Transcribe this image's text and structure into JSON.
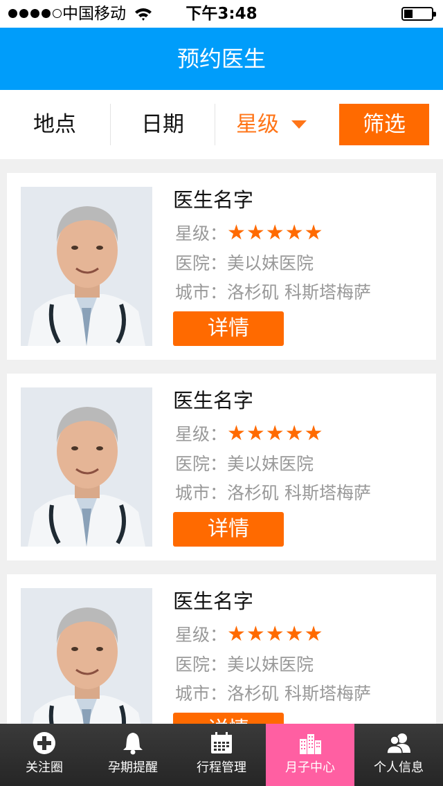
{
  "status_bar": {
    "carrier": "中国移动",
    "time": "下午3:48",
    "signal_bars": 4,
    "signal_total": 5
  },
  "nav": {
    "title": "预约医生"
  },
  "filters": {
    "location": "地点",
    "date": "日期",
    "star": "星级",
    "filter_button": "筛选"
  },
  "doctors": [
    {
      "name": "医生名字",
      "star_label": "星级：",
      "stars": "★★★★★",
      "hospital": "医院：美以妹医院",
      "city": "城市：洛杉矶 科斯塔梅萨",
      "detail": "详情"
    },
    {
      "name": "医生名字",
      "star_label": "星级：",
      "stars": "★★★★★",
      "hospital": "医院：美以妹医院",
      "city": "城市：洛杉矶 科斯塔梅萨",
      "detail": "详情"
    },
    {
      "name": "医生名字",
      "star_label": "星级：",
      "stars": "★★★★★",
      "hospital": "医院：美以妹医院",
      "city": "城市：洛杉矶 科斯塔梅萨",
      "detail": "详情"
    }
  ],
  "tabs": [
    {
      "label": "关注圈",
      "icon": "plus-circle-icon"
    },
    {
      "label": "孕期提醒",
      "icon": "bell-icon"
    },
    {
      "label": "行程管理",
      "icon": "calendar-icon"
    },
    {
      "label": "月子中心",
      "icon": "buildings-icon",
      "active": true
    },
    {
      "label": "个人信息",
      "icon": "users-icon"
    }
  ],
  "colors": {
    "nav_blue": "#009dfa",
    "accent_orange": "#ff6a00",
    "tab_active_pink": "#ff5fa2"
  }
}
